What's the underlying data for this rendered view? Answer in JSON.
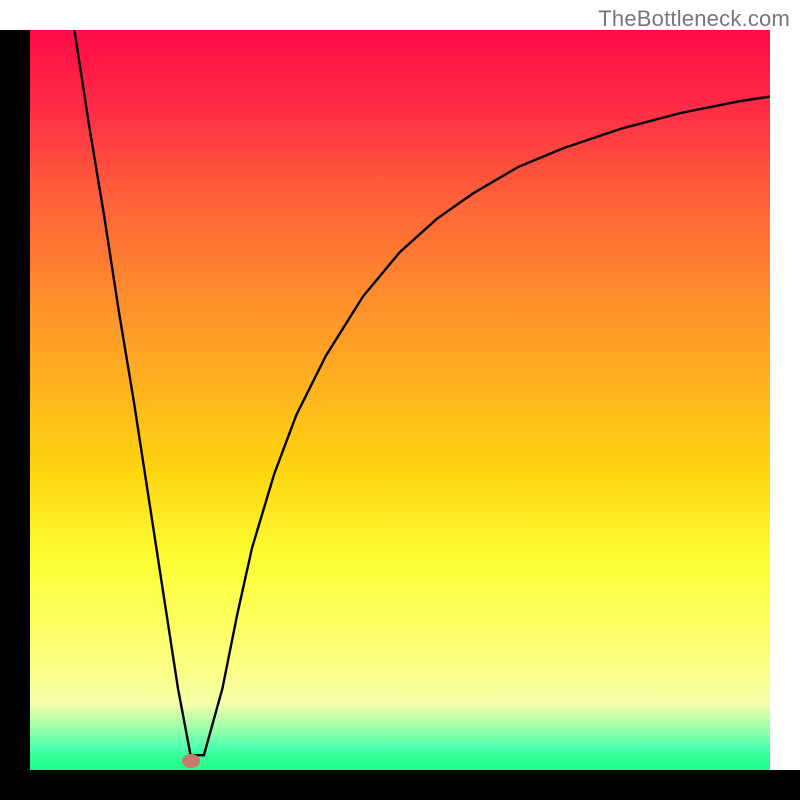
{
  "watermark": "TheBottleneck.com",
  "chart_data": {
    "type": "line",
    "title": "",
    "xlabel": "",
    "ylabel": "",
    "xlim": [
      0,
      100
    ],
    "ylim": [
      0,
      100
    ],
    "grid": false,
    "legend": false,
    "series": [
      {
        "name": "curve",
        "x": [
          6,
          8,
          10,
          12,
          14,
          16,
          18,
          20,
          21.7,
          23.5,
          26,
          28,
          30,
          33,
          36,
          40,
          45,
          50,
          55,
          60,
          66,
          72,
          80,
          88,
          96,
          100
        ],
        "y": [
          100,
          87,
          75,
          62,
          50,
          37,
          24,
          11,
          2,
          2,
          11,
          21,
          30,
          40,
          48,
          56,
          64,
          70,
          74.5,
          78,
          81.5,
          84,
          86.7,
          88.8,
          90.4,
          91
        ]
      }
    ],
    "marker": {
      "x": 21.7,
      "y": 1.2,
      "color": "#c77a6a"
    },
    "gradient_stops": [
      {
        "pos": 0,
        "color": "#ff0b47"
      },
      {
        "pos": 22,
        "color": "#ff5e3a"
      },
      {
        "pos": 48,
        "color": "#ffb21f"
      },
      {
        "pos": 72,
        "color": "#fcff36"
      },
      {
        "pos": 95,
        "color": "#87ffab"
      },
      {
        "pos": 100,
        "color": "#1fff8c"
      }
    ]
  }
}
